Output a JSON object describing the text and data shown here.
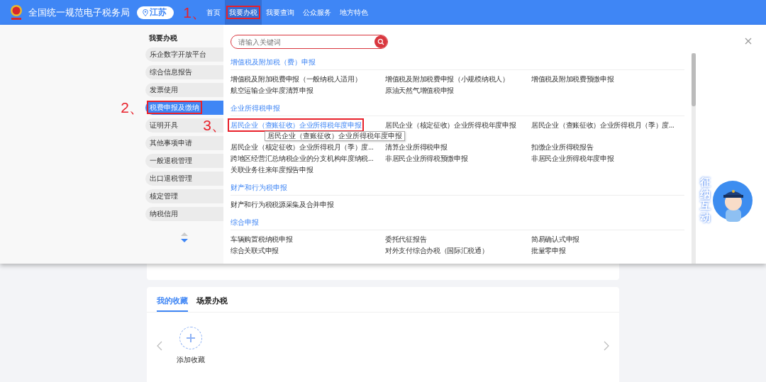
{
  "header": {
    "title": "全国统一规范电子税务局",
    "region": "江苏",
    "nav": [
      {
        "label": "首页",
        "selected": false
      },
      {
        "label": "我要办税",
        "selected": true,
        "callout": "1、"
      },
      {
        "label": "我要查询",
        "selected": false
      },
      {
        "label": "公众服务",
        "selected": false
      },
      {
        "label": "地方特色",
        "selected": false
      }
    ]
  },
  "menu": {
    "sidebar": {
      "title": "我要办税",
      "items": [
        {
          "label": "乐企数字开放平台",
          "selected": false
        },
        {
          "label": "综合信息报告",
          "selected": false
        },
        {
          "label": "发票使用",
          "selected": false
        },
        {
          "label": "税费申报及缴纳",
          "selected": true,
          "callout": "2、"
        },
        {
          "label": "证明开具",
          "selected": false
        },
        {
          "label": "其他事项申请",
          "selected": false
        },
        {
          "label": "一般退税管理",
          "selected": false
        },
        {
          "label": "出口退税管理",
          "selected": false
        },
        {
          "label": "核定管理",
          "selected": false
        },
        {
          "label": "纳税信用",
          "selected": false
        }
      ]
    },
    "search": {
      "placeholder": "请输入关键词"
    },
    "sections": [
      {
        "title": "增值税及附加税（费）申报",
        "links": [
          {
            "label": "增值税及附加税费申报（一般纳税人适用）",
            "active": false
          },
          {
            "label": "增值税及附加税费申报（小规模纳税人）",
            "active": false
          },
          {
            "label": "增值税及附加税费预缴申报",
            "active": false
          },
          {
            "label": "航空运输企业年度清算申报",
            "active": false
          },
          {
            "label": "原油天然气增值税申报",
            "active": false
          }
        ]
      },
      {
        "title": "企业所得税申报",
        "links": [
          {
            "label": "居民企业（查账征收）企业所得税年度申报",
            "active": true,
            "callout": "3、",
            "tooltip": "居民企业（查账征收）企业所得税年度申报"
          },
          {
            "label": "居民企业（核定征收）企业所得税年度申报",
            "active": false
          },
          {
            "label": "居民企业（查账征收）企业所得税月（季）度...",
            "active": false
          },
          {
            "label": "居民企业（核定征收）企业所得税月（季）度...",
            "active": false
          },
          {
            "label": "清算企业所得税申报",
            "active": false
          },
          {
            "label": "扣缴企业所得税报告",
            "active": false
          },
          {
            "label": "跨地区经营汇总纳税企业的分支机构年度纳税...",
            "active": false
          },
          {
            "label": "非居民企业所得税预缴申报",
            "active": false
          },
          {
            "label": "非居民企业所得税年度申报",
            "active": false
          },
          {
            "label": "关联业务往来年度报告申报",
            "active": false
          }
        ]
      },
      {
        "title": "财产和行为税申报",
        "links": [
          {
            "label": "财产和行为税税源采集及合并申报",
            "active": false
          }
        ]
      },
      {
        "title": "综合申报",
        "links": [
          {
            "label": "车辆购置税纳税申报",
            "active": false
          },
          {
            "label": "委托代征报告",
            "active": false
          },
          {
            "label": "简易确认式申报",
            "active": false
          },
          {
            "label": "综合关联式申报",
            "active": false
          },
          {
            "label": "对外支付综合办税（国际汇税通）",
            "active": false
          },
          {
            "label": "批量零申报",
            "active": false
          }
        ]
      }
    ]
  },
  "favorites": {
    "tabs": [
      {
        "label": "我的收藏",
        "selected": true
      },
      {
        "label": "场景办税",
        "selected": false
      }
    ],
    "add_label": "添加收藏"
  },
  "assistant": {
    "label": "征纳互动"
  }
}
